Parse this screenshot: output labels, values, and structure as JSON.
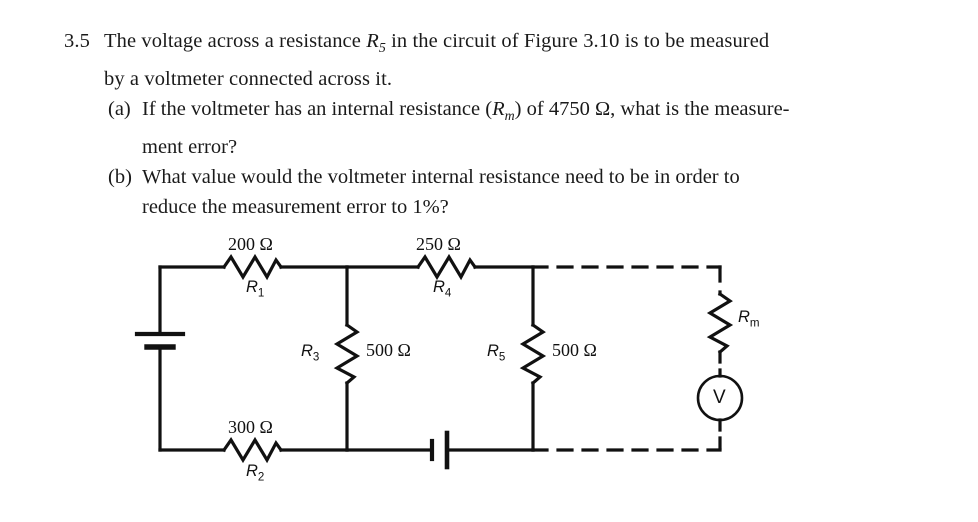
{
  "problem": {
    "number": "3.5",
    "lines": [
      "The voltage across a resistance R5 in the circuit of Figure 3.10 is to be measured",
      "by a voltmeter connected across it."
    ],
    "line1_pre": "The voltage across a resistance ",
    "line1_var": "R",
    "line1_sub": "5",
    "line1_post": " in the circuit of Figure 3.10 is to be measured",
    "line2": "by a voltmeter connected across it.",
    "parts": [
      {
        "tag": "(a)",
        "pre": "If the voltmeter has an internal resistance (",
        "var": "R",
        "sub": "m",
        "post": ") of 4750 Ω, what is the measure-",
        "cont": "ment error?"
      },
      {
        "tag": "(b)",
        "pre": "What value would the voltmeter internal resistance need to be in order to",
        "var": "",
        "sub": "",
        "post": "",
        "cont": "reduce the measurement error to 1%?"
      }
    ]
  },
  "figure": {
    "name": "circuit-figure-3-10",
    "stroke_color": "#111111",
    "components": [
      {
        "id": "R1",
        "label": "R",
        "sub": "1",
        "value": "200 Ω",
        "type": "resistor-horizontal"
      },
      {
        "id": "R2",
        "label": "R",
        "sub": "2",
        "value": "300 Ω",
        "type": "resistor-horizontal"
      },
      {
        "id": "R3",
        "label": "R",
        "sub": "3",
        "value": "500 Ω",
        "type": "resistor-vertical"
      },
      {
        "id": "R4",
        "label": "R",
        "sub": "4",
        "value": "250 Ω",
        "type": "resistor-horizontal"
      },
      {
        "id": "R5",
        "label": "R",
        "sub": "5",
        "value": "500 Ω",
        "type": "resistor-vertical"
      },
      {
        "id": "Rm",
        "label": "R",
        "sub": "m",
        "value": "",
        "type": "resistor-vertical"
      },
      {
        "id": "V1",
        "label": "",
        "sub": "",
        "value": "",
        "type": "battery-vertical"
      },
      {
        "id": "V2",
        "label": "",
        "sub": "",
        "value": "",
        "type": "battery-horizontal"
      },
      {
        "id": "meter",
        "label": "V",
        "sub": "",
        "value": "",
        "type": "voltmeter"
      }
    ],
    "labels": {
      "r1_value": "200 Ω",
      "r1_name": "R",
      "r1_sub": "1",
      "r4_value": "250 Ω",
      "r4_name": "R",
      "r4_sub": "4",
      "r2_value": "300 Ω",
      "r2_name": "R",
      "r2_sub": "2",
      "r3_name": "R",
      "r3_sub": "3",
      "r3_value": "500 Ω",
      "r5_name": "R",
      "r5_sub": "5",
      "r5_value": "500 Ω",
      "rm_name": "R",
      "rm_sub": "m",
      "meter_symbol": "V"
    }
  }
}
